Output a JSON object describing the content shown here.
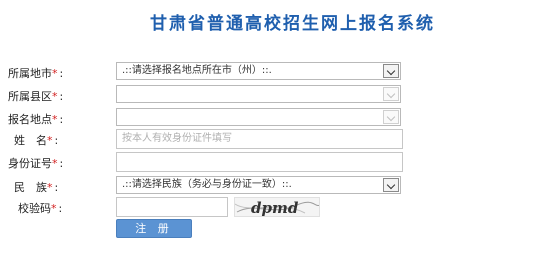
{
  "header": {
    "title": "甘肃省普通高校招生网上报名系统"
  },
  "form": {
    "city": {
      "label": "所属地市",
      "selected": ".::请选择报名地点所在市（州）::."
    },
    "county": {
      "label": "所属县区",
      "selected": ""
    },
    "site": {
      "label": "报名地点",
      "selected": ""
    },
    "name": {
      "label": "姓　名",
      "placeholder": "按本人有效身份证件填写"
    },
    "id_number": {
      "label": "身份证号",
      "value": ""
    },
    "ethnicity": {
      "label": "民　族",
      "selected": ".::请选择民族（务必与身份证一致）::."
    },
    "captcha": {
      "label": "校验码",
      "value": "",
      "image_text": "dpmd"
    },
    "required_mark": "*",
    "colon": ":"
  },
  "actions": {
    "register_label": "注 册"
  },
  "colors": {
    "title": "#1f5fae",
    "required": "#d21f1f",
    "button": "#5b93d3"
  },
  "icons": {
    "dropdown": "chevron-down-icon"
  }
}
